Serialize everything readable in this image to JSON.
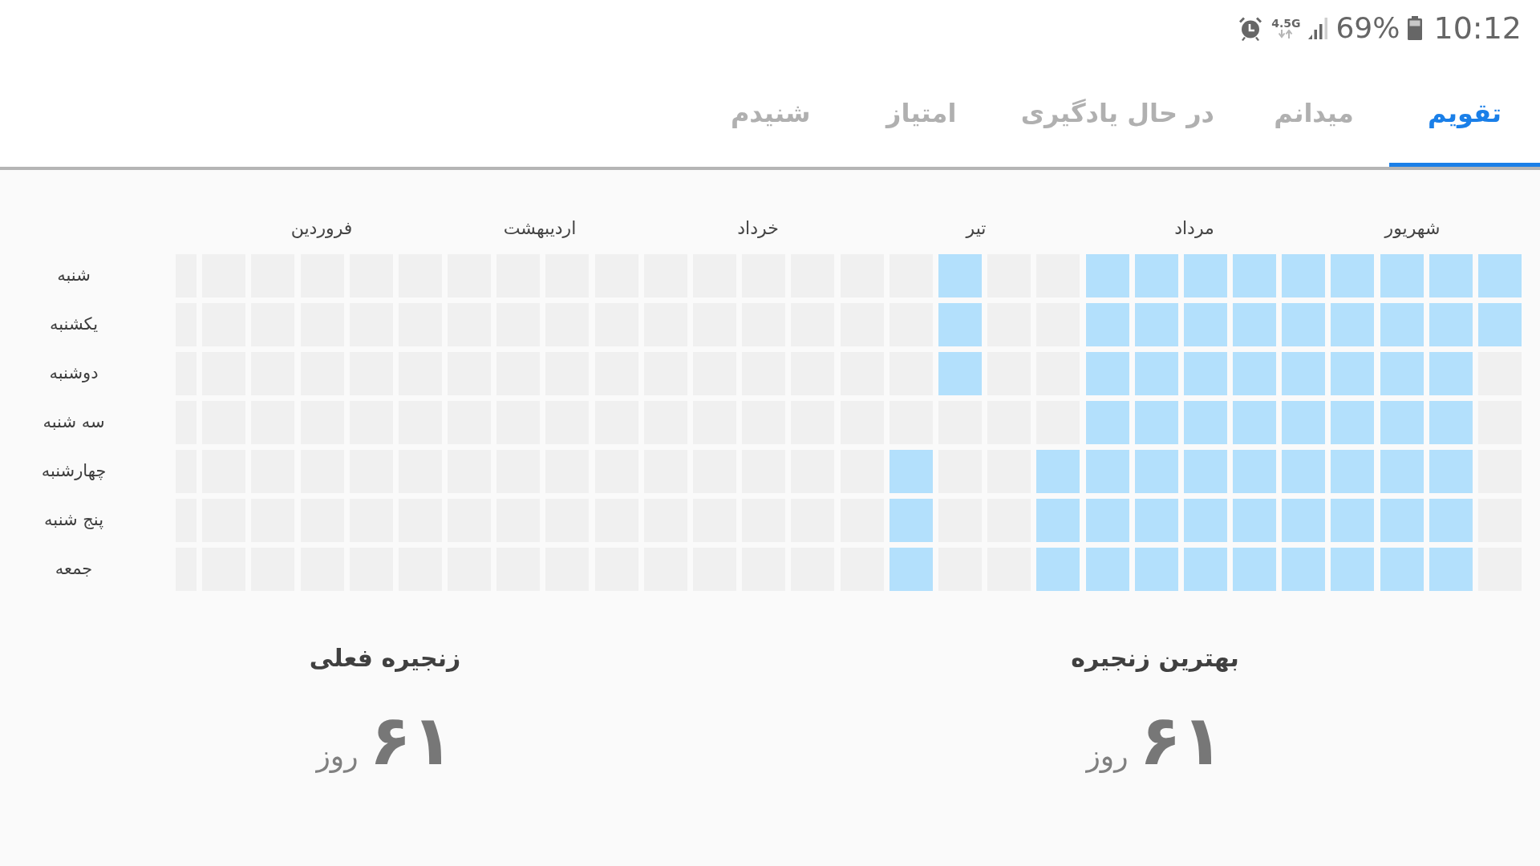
{
  "status_bar": {
    "network": "4.5G",
    "battery": "69%",
    "time": "10:12"
  },
  "tabs": [
    {
      "label": "تقویم",
      "selected": true
    },
    {
      "label": "میدانم",
      "selected": false
    },
    {
      "label": "در حال یادگیری",
      "selected": false
    },
    {
      "label": "امتیاز",
      "selected": false
    },
    {
      "label": "شنیدم",
      "selected": false
    }
  ],
  "calendar": {
    "months": [
      "شهریور",
      "مرداد",
      "تیر",
      "خرداد",
      "اردیبهشت",
      "فروردین"
    ],
    "weekdays": [
      "شنبه",
      "یکشنبه",
      "دوشنبه",
      "سه شنبه",
      "چهارشنبه",
      "پنج شنبه",
      "جمعه"
    ],
    "weeks": [
      [
        true,
        true,
        false,
        false,
        false,
        false,
        false
      ],
      [
        true,
        true,
        true,
        true,
        true,
        true,
        true
      ],
      [
        true,
        true,
        true,
        true,
        true,
        true,
        true
      ],
      [
        true,
        true,
        true,
        true,
        true,
        true,
        true
      ],
      [
        true,
        true,
        true,
        true,
        true,
        true,
        true
      ],
      [
        true,
        true,
        true,
        true,
        true,
        true,
        true
      ],
      [
        true,
        true,
        true,
        true,
        true,
        true,
        true
      ],
      [
        true,
        true,
        true,
        true,
        true,
        true,
        true
      ],
      [
        true,
        true,
        true,
        true,
        true,
        true,
        true
      ],
      [
        false,
        false,
        false,
        false,
        true,
        true,
        true
      ],
      [
        false,
        false,
        false,
        false,
        false,
        false,
        false
      ],
      [
        true,
        true,
        true,
        false,
        false,
        false,
        false
      ],
      [
        false,
        false,
        false,
        false,
        true,
        true,
        true
      ],
      [
        false,
        false,
        false,
        false,
        false,
        false,
        false
      ],
      [
        false,
        false,
        false,
        false,
        false,
        false,
        false
      ],
      [
        false,
        false,
        false,
        false,
        false,
        false,
        false
      ],
      [
        false,
        false,
        false,
        false,
        false,
        false,
        false
      ],
      [
        false,
        false,
        false,
        false,
        false,
        false,
        false
      ],
      [
        false,
        false,
        false,
        false,
        false,
        false,
        false
      ],
      [
        false,
        false,
        false,
        false,
        false,
        false,
        false
      ],
      [
        false,
        false,
        false,
        false,
        false,
        false,
        false
      ],
      [
        false,
        false,
        false,
        false,
        false,
        false,
        false
      ],
      [
        false,
        false,
        false,
        false,
        false,
        false,
        false
      ],
      [
        false,
        false,
        false,
        false,
        false,
        false,
        false
      ],
      [
        false,
        false,
        false,
        false,
        false,
        false,
        false
      ],
      [
        false,
        false,
        false,
        false,
        false,
        false,
        false
      ],
      [
        false,
        false,
        false,
        false,
        false,
        false,
        false
      ],
      [
        false,
        false,
        false,
        false,
        false,
        false,
        false
      ]
    ]
  },
  "streaks": [
    {
      "title": "بهترین زنجیره",
      "value": "۶۱",
      "unit": "روز"
    },
    {
      "title": "زنجیره فعلی",
      "value": "۶۱",
      "unit": "روز"
    }
  ]
}
